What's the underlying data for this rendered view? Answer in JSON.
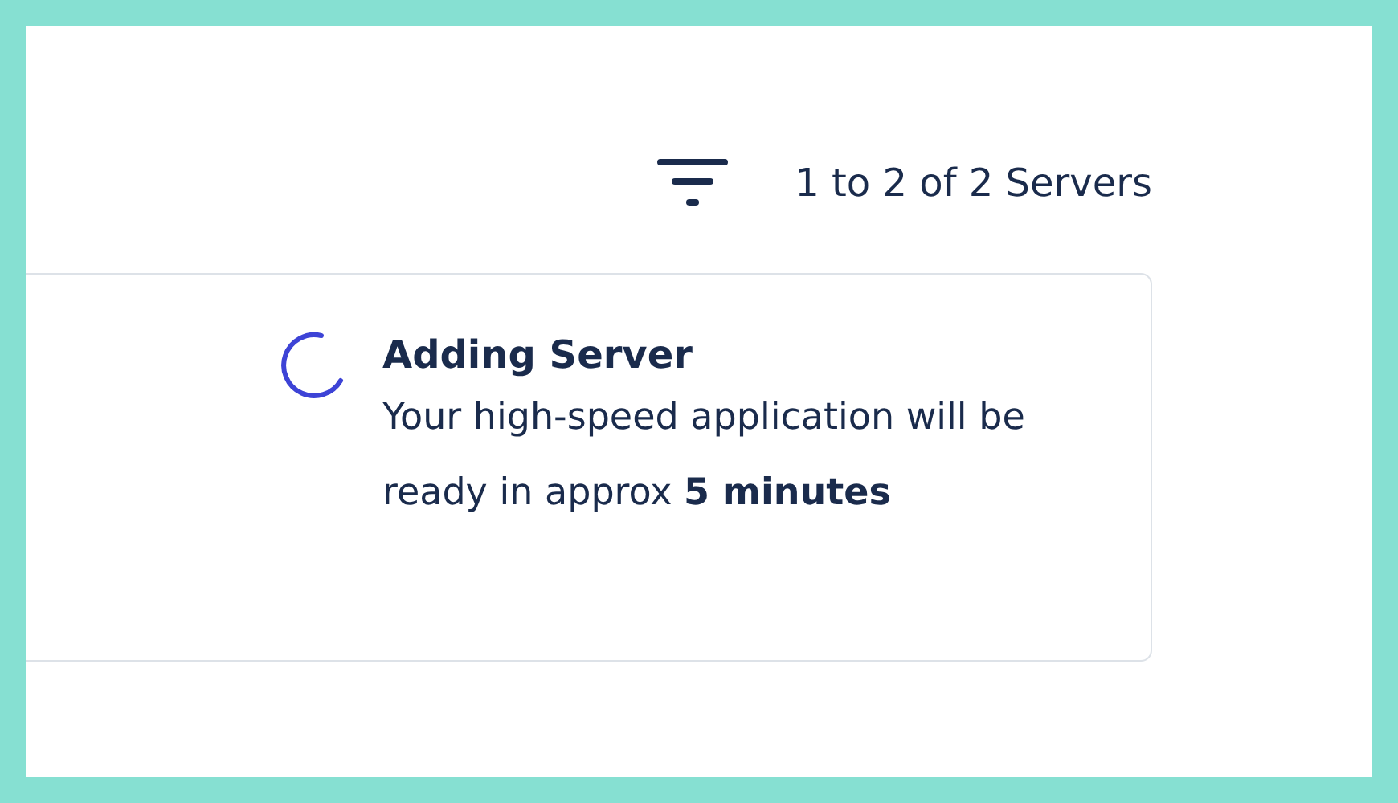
{
  "toolbar": {
    "count_label": "1 to 2 of 2 Servers"
  },
  "notice": {
    "title": "Adding Server",
    "message": "Your high-speed application will be ready in approx **5 minutes**"
  }
}
